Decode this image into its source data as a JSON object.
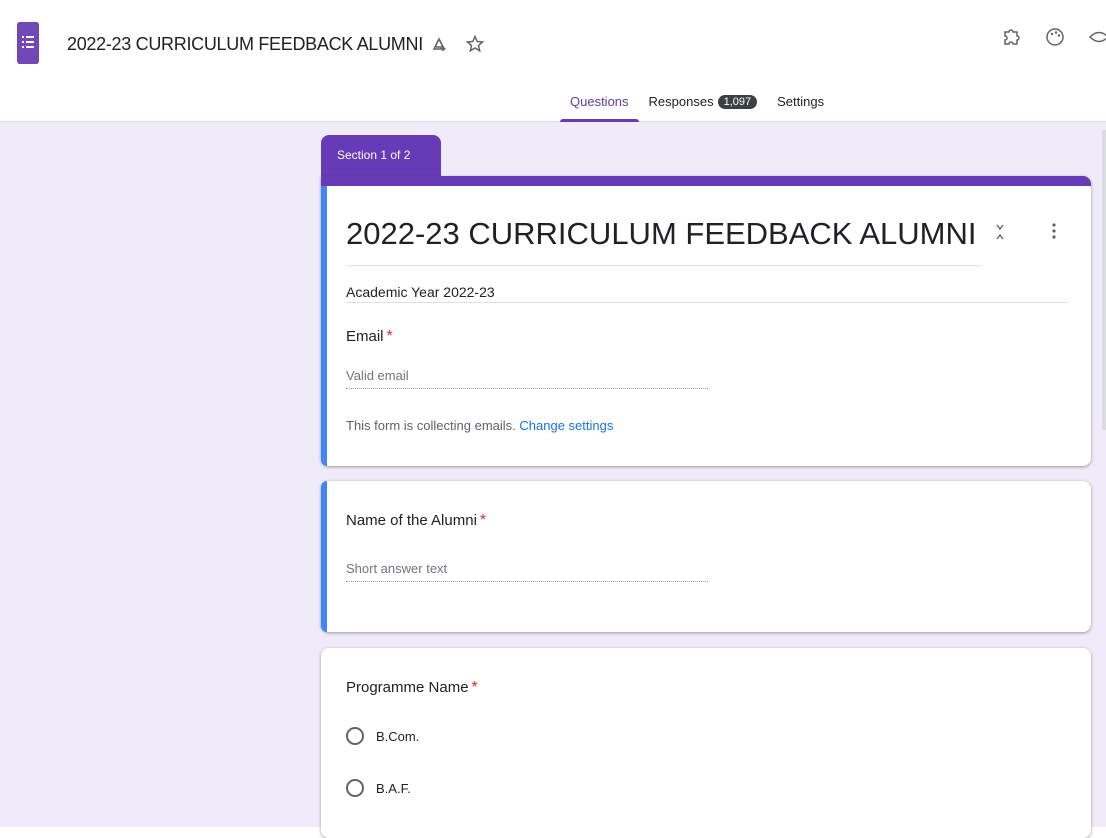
{
  "app": {
    "doc_title": "2022-23 CURRICULUM FEEDBACK ALUMNI"
  },
  "tabs": [
    {
      "label": "Questions",
      "active": true
    },
    {
      "label": "Responses",
      "badge": "1,097"
    },
    {
      "label": "Settings"
    }
  ],
  "section": {
    "label": "Section 1 of 2"
  },
  "form": {
    "title": "2022-23 CURRICULUM FEEDBACK ALUMNI",
    "description": "Academic Year 2022-23",
    "email": {
      "label": "Email",
      "required_mark": "*",
      "placeholder": "Valid email",
      "notice": "This form is collecting emails.",
      "notice_link": "Change settings"
    }
  },
  "questions": [
    {
      "label": "Name of the Alumni",
      "required_mark": "*",
      "answer_hint": "Short answer text"
    },
    {
      "label": "Programme Name",
      "required_mark": "*",
      "options": [
        "B.Com.",
        "B.A.F."
      ]
    }
  ],
  "colors": {
    "brand": "#673ab7",
    "accent_left_bar": "#4285f4",
    "canvas": "#f0ebf8",
    "required": "#d93025",
    "link": "#1a73e8"
  },
  "icons": [
    "forms-app-icon",
    "add-to-drive-icon",
    "star-icon",
    "puzzle-addon-icon",
    "palette-icon",
    "preview-eye-icon",
    "collapse-icon",
    "more-vert-icon"
  ]
}
